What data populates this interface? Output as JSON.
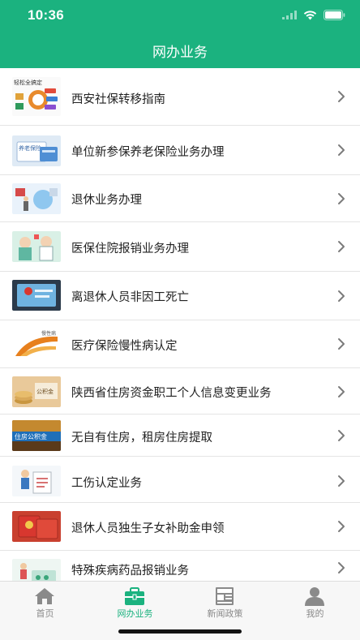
{
  "status_bar": {
    "time": "10:36"
  },
  "header": {
    "title": "网办业务"
  },
  "list": {
    "items": [
      {
        "label": "西安社保转移指南"
      },
      {
        "label": "单位新参保养老保险业务办理"
      },
      {
        "label": "退休业务办理"
      },
      {
        "label": "医保住院报销业务办理"
      },
      {
        "label": "离退休人员非因工死亡"
      },
      {
        "label": "医疗保险慢性病认定"
      },
      {
        "label": "陕西省住房资金职工个人信息变更业务"
      },
      {
        "label": "无自有住房，租房住房提取"
      },
      {
        "label": "工伤认定业务"
      },
      {
        "label": "退休人员独生子女补助金申领"
      },
      {
        "label": "特殊疾病药品报销业务"
      }
    ],
    "thumb_captions": {
      "item0": "轻松全搞定",
      "item1": "养老保险",
      "item6": "公积金",
      "item7": "住房公积金",
      "item5": "慢性病"
    }
  },
  "tabbar": {
    "tabs": [
      {
        "label": "首页",
        "icon": "home-icon"
      },
      {
        "label": "网办业务",
        "icon": "briefcase-icon"
      },
      {
        "label": "新闻政策",
        "icon": "newspaper-icon"
      },
      {
        "label": "我的",
        "icon": "person-icon"
      }
    ],
    "active_index": 1
  },
  "colors": {
    "brand_green": "#1bb27f",
    "inactive_tab": "#8a8a8a",
    "divider": "#e4e4e4"
  }
}
